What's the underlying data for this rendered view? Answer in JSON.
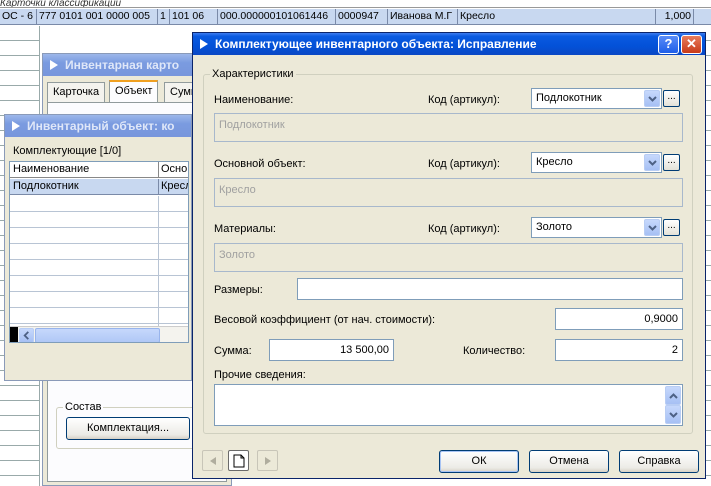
{
  "background": {
    "top_text": "Карточки классификации",
    "row": [
      "ОС - 6",
      "777 0101 001 0000 005",
      "1",
      "101 06",
      "000.000000101061446",
      "0000947",
      "Иванова М.Г",
      "Кресло",
      "1,000"
    ]
  },
  "win_card": {
    "title": "Инвентарная карто",
    "tabs": [
      "Карточка",
      "Объект",
      "Сумм"
    ],
    "group_label": "Состав",
    "kit_button": "Комплектация..."
  },
  "win_object": {
    "title": "Инвентарный объект: ко",
    "header": "Комплектующие [1/0]",
    "columns": [
      "Наименование",
      "Основ"
    ],
    "rows": [
      [
        "Подлокотник",
        "Кресл"
      ]
    ]
  },
  "dialog": {
    "title": "Комплектующее инвентарного объекта: Исправление",
    "help_btn": "?",
    "close_btn": "✕",
    "group_label": "Характеристики",
    "name": {
      "label": "Наименование:",
      "code_label": "Код (артикул):",
      "combo_value": "Подлокотник",
      "display": "Подлокотник"
    },
    "base": {
      "label": "Основной объект:",
      "code_label": "Код (артикул):",
      "combo_value": "Кресло",
      "display": "Кресло"
    },
    "material": {
      "label": "Материалы:",
      "code_label": "Код (артикул):",
      "combo_value": "Золото",
      "display": "Золото"
    },
    "sizes": {
      "label": "Размеры:",
      "value": ""
    },
    "weight": {
      "label": "Весовой коэффициент (от нач. стоимости):",
      "value": "0,9000"
    },
    "sum": {
      "label": "Сумма:",
      "value": "13 500,00"
    },
    "qty": {
      "label": "Количество:",
      "value": "2"
    },
    "other": {
      "label": "Прочие сведения:",
      "value": ""
    },
    "buttons": {
      "ok": "ОК",
      "cancel": "Отмена",
      "help": "Справка"
    },
    "dots_label": "..."
  }
}
